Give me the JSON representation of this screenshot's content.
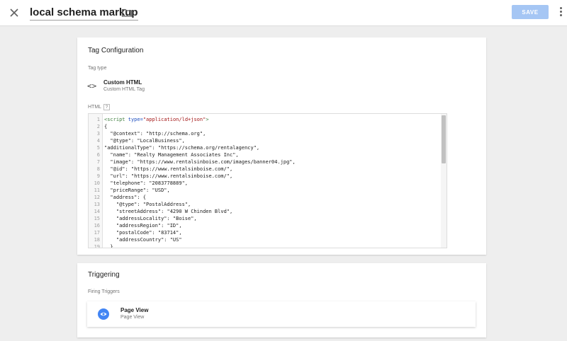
{
  "header": {
    "title": "local schema markup",
    "save_label": "SAVE",
    "icons": {
      "close": "close-icon",
      "folder": "folder-icon",
      "more": "more-vert-icon"
    }
  },
  "tag_config": {
    "title": "Tag Configuration",
    "tag_type_label": "Tag type",
    "tag_type_name": "Custom HTML",
    "tag_type_sub": "Custom HTML Tag",
    "tag_type_icon": "code-brackets-icon",
    "html_label": "HTML",
    "help_glyph": "?",
    "code_lines": [
      {
        "n": "1",
        "segments": [
          {
            "t": "<script",
            "c": "tag"
          },
          {
            "t": " type=",
            "c": "attr"
          },
          {
            "t": "\"application/ld+json\"",
            "c": "str"
          },
          {
            "t": ">",
            "c": "tag"
          }
        ]
      },
      {
        "n": "2",
        "segments": [
          {
            "t": "{",
            "c": ""
          }
        ]
      },
      {
        "n": "3",
        "segments": [
          {
            "t": "  \"@context\": \"http://schema.org\",",
            "c": ""
          }
        ]
      },
      {
        "n": "4",
        "segments": [
          {
            "t": "  \"@type\": \"LocalBusiness\",",
            "c": ""
          }
        ]
      },
      {
        "n": "5",
        "segments": [
          {
            "t": "\"additionalType\": \"https://schema.org/rentalagency\",",
            "c": ""
          }
        ]
      },
      {
        "n": "6",
        "segments": [
          {
            "t": "  \"name\": \"Realty Management Associates Inc\",",
            "c": ""
          }
        ]
      },
      {
        "n": "7",
        "segments": [
          {
            "t": "  \"image\": \"https://www.rentalsinboise.com/images/banner04.jpg\",",
            "c": ""
          }
        ]
      },
      {
        "n": "8",
        "segments": [
          {
            "t": "  \"@id\": \"https://www.rentalsinboise.com/\",",
            "c": ""
          }
        ]
      },
      {
        "n": "9",
        "segments": [
          {
            "t": "  \"url\": \"https://www.rentalsinboise.com/\",",
            "c": ""
          }
        ]
      },
      {
        "n": "10",
        "segments": [
          {
            "t": "  \"telephone\": \"2083778889\",",
            "c": ""
          }
        ]
      },
      {
        "n": "11",
        "segments": [
          {
            "t": "  \"priceRange\": \"USD\",",
            "c": ""
          }
        ]
      },
      {
        "n": "12",
        "segments": [
          {
            "t": "  \"address\": {",
            "c": ""
          }
        ]
      },
      {
        "n": "13",
        "segments": [
          {
            "t": "    \"@type\": \"PostalAddress\",",
            "c": ""
          }
        ]
      },
      {
        "n": "14",
        "segments": [
          {
            "t": "    \"streetAddress\": \"4290 W Chinden Blvd\",",
            "c": ""
          }
        ]
      },
      {
        "n": "15",
        "segments": [
          {
            "t": "    \"addressLocality\": \"Boise\",",
            "c": ""
          }
        ]
      },
      {
        "n": "16",
        "segments": [
          {
            "t": "    \"addressRegion\": \"ID\",",
            "c": ""
          }
        ]
      },
      {
        "n": "17",
        "segments": [
          {
            "t": "    \"postalCode\": \"83714\",",
            "c": ""
          }
        ]
      },
      {
        "n": "18",
        "segments": [
          {
            "t": "    \"addressCountry\": \"US\"",
            "c": ""
          }
        ]
      },
      {
        "n": "19",
        "segments": [
          {
            "t": "  },",
            "c": ""
          }
        ]
      }
    ]
  },
  "triggering": {
    "title": "Triggering",
    "firing_label": "Firing Triggers",
    "trigger_name": "Page View",
    "trigger_sub": "Page View",
    "trigger_icon": "eye-icon"
  },
  "colors": {
    "accent": "#4285f4",
    "save_disabled": "#a5c6f4",
    "background": "#eeeeee"
  }
}
